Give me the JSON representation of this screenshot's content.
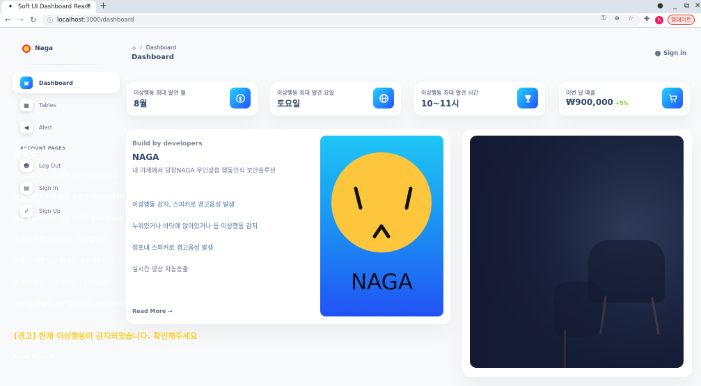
{
  "browser": {
    "tab_title": "Soft UI Dashboard React",
    "url_host": "localhost",
    "url_rest": ":3000/dashboard",
    "profile_initial": "h",
    "update_label": "업데이트"
  },
  "sidebar": {
    "brand": "Naga",
    "items": [
      {
        "label": "Dashboard",
        "icon": "shop-icon",
        "active": true
      },
      {
        "label": "Tables",
        "icon": "office-icon",
        "active": false
      },
      {
        "label": "Alert",
        "icon": "megaphone-icon",
        "active": false
      }
    ],
    "section_label": "ACCOUNT PAGES",
    "account_items": [
      {
        "label": "Log Out",
        "icon": "customer-support-icon"
      },
      {
        "label": "Sign In",
        "icon": "document-icon"
      },
      {
        "label": "Sign Up",
        "icon": "spaceship-icon"
      }
    ]
  },
  "header": {
    "breadcrumb_current": "Dashboard",
    "title": "Dashboard",
    "sign_in": "Sign in"
  },
  "stats": [
    {
      "label": "이상행동 최대 발견 월",
      "value": "8월",
      "delta": "",
      "icon": "dollar-icon"
    },
    {
      "label": "이상행동 최대 발견 요일",
      "value": "토요일",
      "delta": "",
      "icon": "globe-icon"
    },
    {
      "label": "이상행동 최대 발견 시간",
      "value": "10~11시",
      "delta": "",
      "icon": "trophy-icon"
    },
    {
      "label": "이번 달 매출",
      "value": "₩900,000",
      "delta": "+5%",
      "icon": "cart-icon"
    }
  ],
  "build": {
    "eyebrow": "Build by developers",
    "title": "NAGA",
    "description": "내 가게에서 당장NAGA 무인상점 행동인식 보안솔루션",
    "items": [
      "이상행동 감지, 스피커로 경고음성 발생",
      "누워있거나 바닥에 앉아있거나 등 이상행동 감지",
      "점포내 스피커로 경고음성 발생",
      "실시간 영상 자동송출"
    ],
    "read_more": "Read More →",
    "logo_word": "NAGA"
  },
  "status": {
    "title": "상황판",
    "lines": [
      "이상행동이 가장 많은 달은 8월달입니다.",
      "이상행동이 가장 많은 요일은 금요일입니다.",
      "이상행동이 가장 많은 시간은 23시입니다.",
      "매출이 가장 많은 달은 9월달입니다.",
      "매출이 가장 많은 요일은 수요일입니다.",
      "매출이 가장 많은 시간은 18시입니다.",
      "이번 달 매출은 저번 달에 비해 ₩10,000 증가했습니다."
    ],
    "warning": "[경고] 현재 이상행동이 감지되었습니다. 확인해주세요",
    "read_more": "Read More →"
  },
  "colors": {
    "accent_gradient_start": "#2152ff",
    "accent_gradient_end": "#21d4fd",
    "warning": "#fbcf33",
    "positive": "#82d616"
  }
}
